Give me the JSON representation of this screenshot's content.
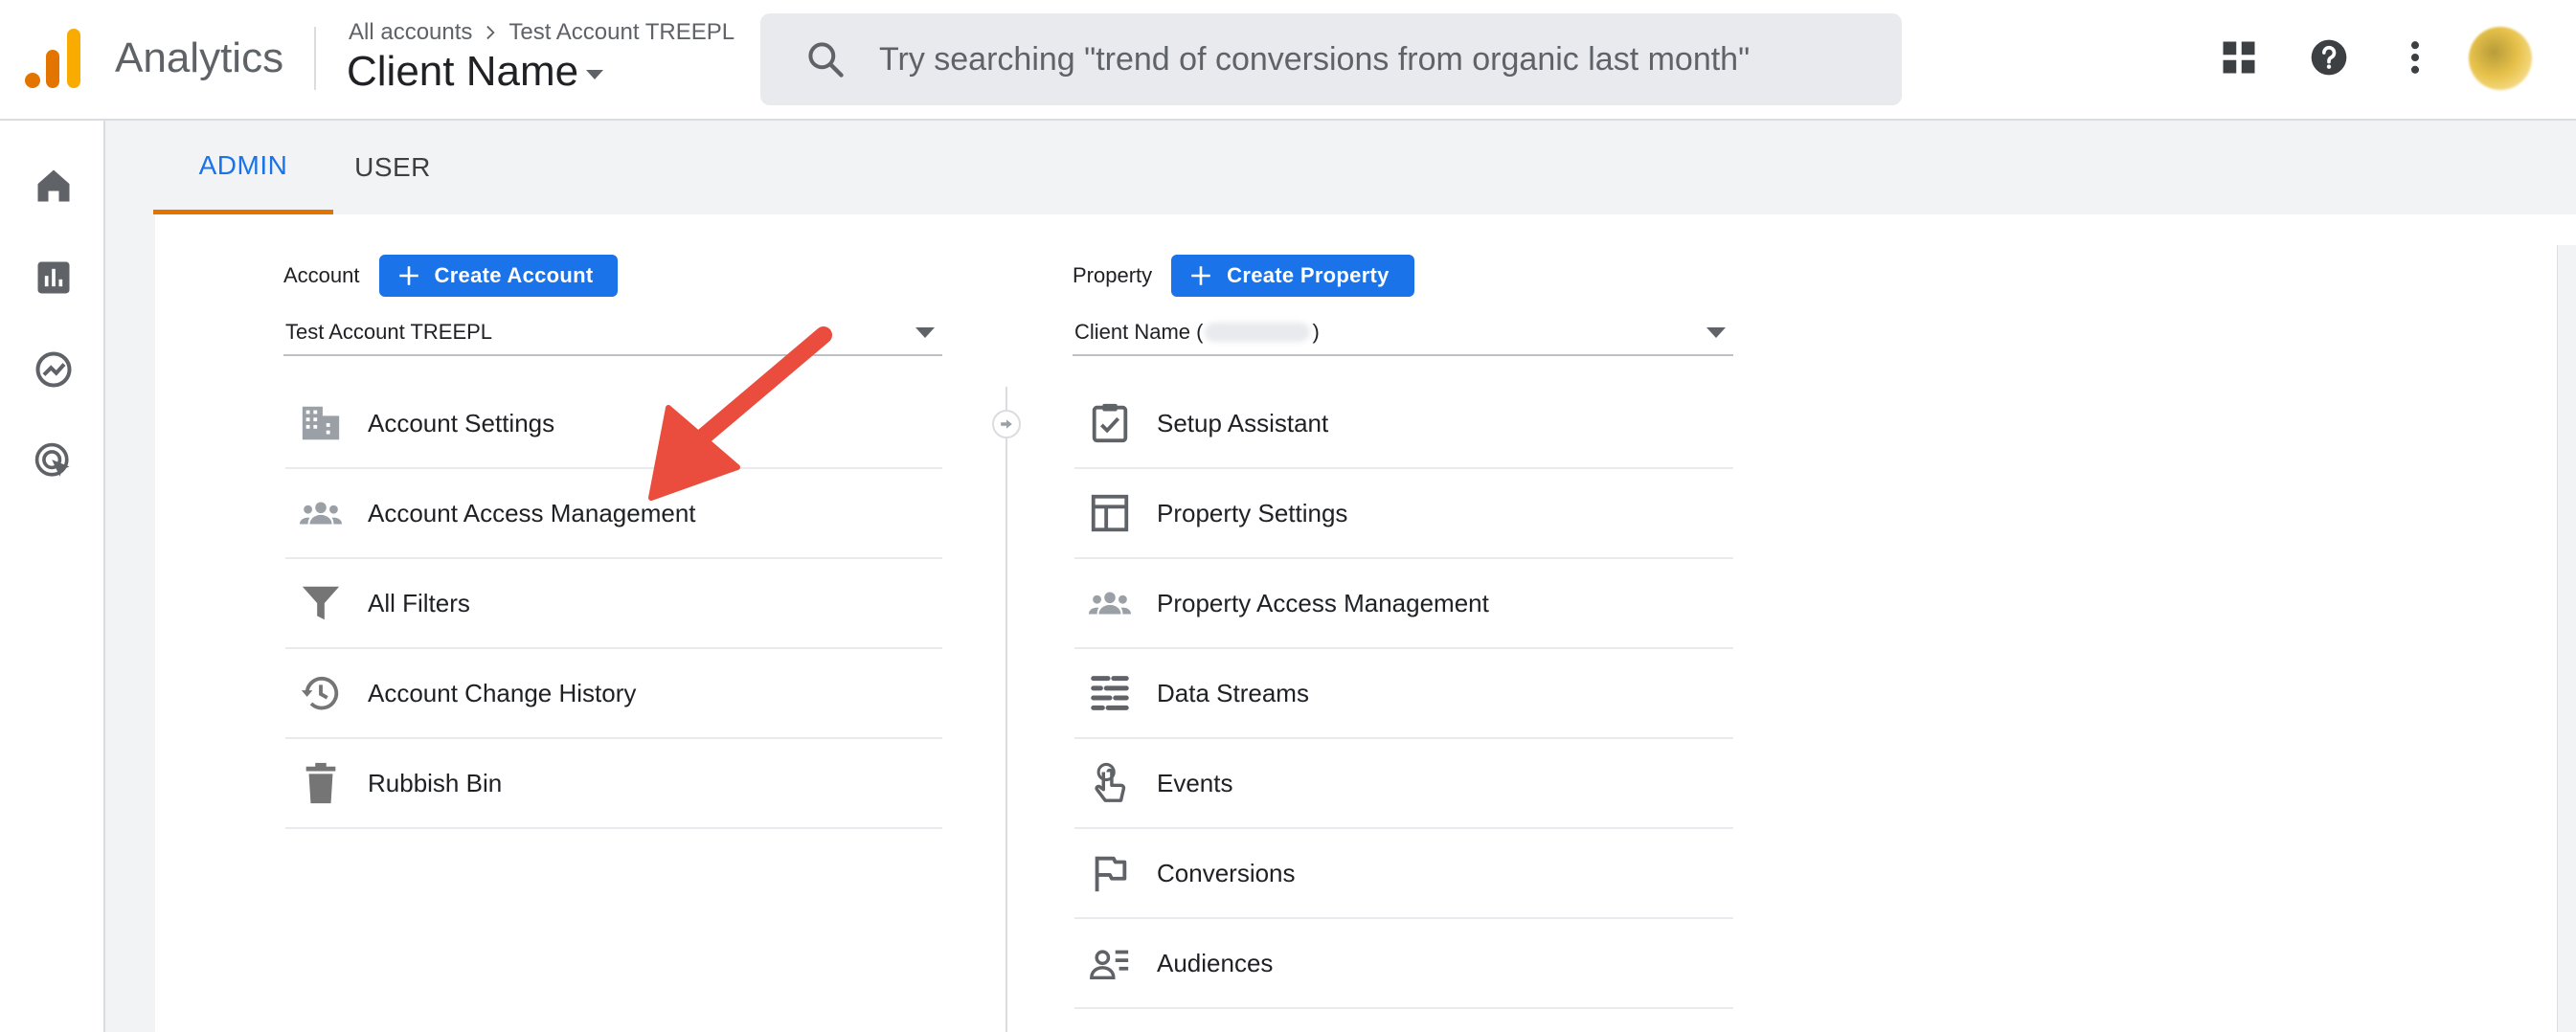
{
  "app": {
    "title": "Analytics"
  },
  "breadcrumb": {
    "all_accounts": "All accounts",
    "account": "Test Account TREEPL"
  },
  "property_selector": {
    "name": "Client Name"
  },
  "search": {
    "placeholder": "Try searching \"trend of conversions from organic last month\""
  },
  "top_icons": [
    "apps-grid-icon",
    "help-icon",
    "more-vert-icon"
  ],
  "rail_icons": [
    "home-icon",
    "reports-icon",
    "explore-icon",
    "advertising-icon"
  ],
  "tabs": [
    {
      "label": "ADMIN",
      "active": true
    },
    {
      "label": "USER",
      "active": false
    }
  ],
  "account_column": {
    "heading": "Account",
    "create_label": "Create Account",
    "selected": "Test Account TREEPL",
    "items": [
      {
        "label": "Account Settings",
        "icon": "building-icon"
      },
      {
        "label": "Account Access Management",
        "icon": "people-icon"
      },
      {
        "label": "All Filters",
        "icon": "filter-icon"
      },
      {
        "label": "Account Change History",
        "icon": "history-icon"
      },
      {
        "label": "Rubbish Bin",
        "icon": "trash-icon"
      }
    ]
  },
  "property_column": {
    "heading": "Property",
    "create_label": "Create Property",
    "selected_prefix": "Client Name (",
    "selected_suffix": ")",
    "items": [
      {
        "label": "Setup Assistant",
        "icon": "checklist-icon"
      },
      {
        "label": "Property Settings",
        "icon": "layout-icon"
      },
      {
        "label": "Property Access Management",
        "icon": "people-icon"
      },
      {
        "label": "Data Streams",
        "icon": "data-streams-icon"
      },
      {
        "label": "Events",
        "icon": "touch-icon"
      },
      {
        "label": "Conversions",
        "icon": "flag-icon"
      },
      {
        "label": "Audiences",
        "icon": "audiences-icon"
      }
    ]
  },
  "colors": {
    "accent_blue": "#1a73e8",
    "tab_underline": "#e37400",
    "annotation_arrow": "#ea4d3d"
  }
}
